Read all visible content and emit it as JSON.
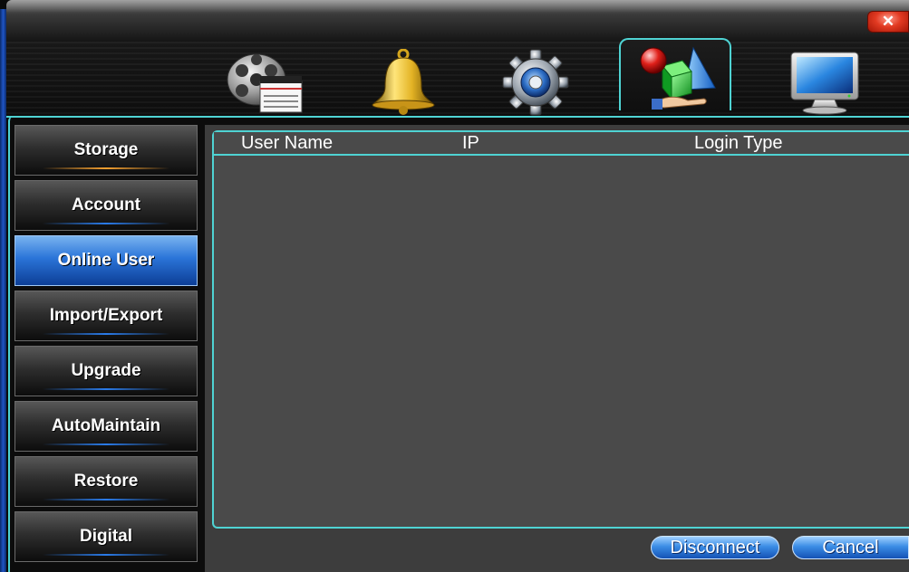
{
  "window": {
    "close_glyph": "✕",
    "accent_color": "#4fd3d3"
  },
  "toolbar": {
    "tabs": [
      {
        "icon": "film-reel-icon",
        "active": false
      },
      {
        "icon": "alarm-bell-icon",
        "active": false
      },
      {
        "icon": "gear-icon",
        "active": false
      },
      {
        "icon": "advanced-shapes-icon",
        "active": true
      },
      {
        "icon": "monitor-icon",
        "active": false
      }
    ]
  },
  "sidebar": {
    "items": [
      {
        "label": "Storage",
        "active": false
      },
      {
        "label": "Account",
        "active": false
      },
      {
        "label": "Online User",
        "active": true
      },
      {
        "label": "Import/Export",
        "active": false
      },
      {
        "label": "Upgrade",
        "active": false
      },
      {
        "label": "AutoMaintain",
        "active": false
      },
      {
        "label": "Restore",
        "active": false
      },
      {
        "label": "Digital",
        "active": false
      }
    ]
  },
  "table": {
    "columns": [
      "User Name",
      "IP",
      "Login Type"
    ],
    "rows": []
  },
  "buttons": {
    "disconnect": "Disconnect",
    "cancel": "Cancel"
  }
}
